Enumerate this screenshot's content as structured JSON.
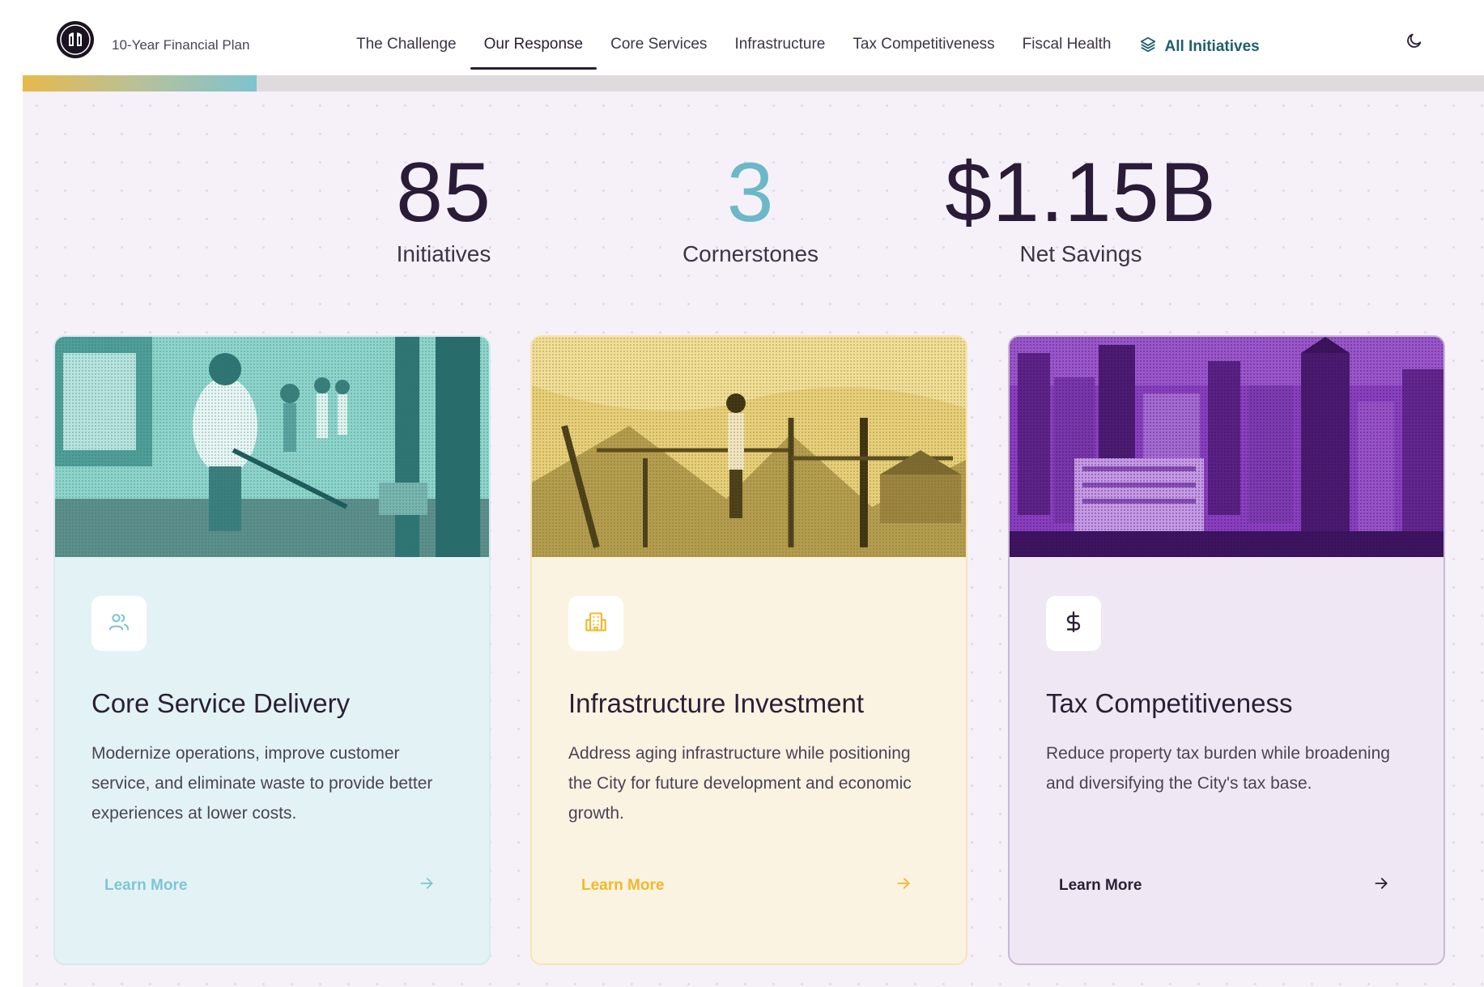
{
  "brand": {
    "title": "10-Year Financial Plan"
  },
  "nav": {
    "links": [
      {
        "label": "The Challenge"
      },
      {
        "label": "Our Response"
      },
      {
        "label": "Core Services"
      },
      {
        "label": "Infrastructure"
      },
      {
        "label": "Tax Competitiveness"
      },
      {
        "label": "Fiscal Health"
      }
    ],
    "active": "Our Response",
    "all_initiatives": "All Initiatives",
    "theme_icon": "moon-icon"
  },
  "progress": {
    "fraction": 0.16
  },
  "stats": [
    {
      "value": "85",
      "label": "Initiatives"
    },
    {
      "value": "3",
      "label": "Cornerstones"
    },
    {
      "value": "$1.15B",
      "label": "Net Savings"
    }
  ],
  "cards": [
    {
      "title": "Core Service Delivery",
      "description": "Modernize operations, improve customer service, and eliminate waste to provide better experiences at lower costs.",
      "cta": "Learn More",
      "icon": "users-icon",
      "accent": "#7fc5d2"
    },
    {
      "title": "Infrastructure Investment",
      "description": "Address aging infrastructure while positioning the City for future development and economic growth.",
      "cta": "Learn More",
      "icon": "building-icon",
      "accent": "#f0b92a"
    },
    {
      "title": "Tax Competitiveness",
      "description": "Reduce property tax burden while broadening and diversifying the City's tax base.",
      "cta": "Learn More",
      "icon": "dollar-icon",
      "accent": "#2a1f33"
    }
  ],
  "colors": {
    "dark": "#2a1b38",
    "teal": "#6cb8c8",
    "yellow": "#e7b94a",
    "purple": "#7a2fa8"
  }
}
